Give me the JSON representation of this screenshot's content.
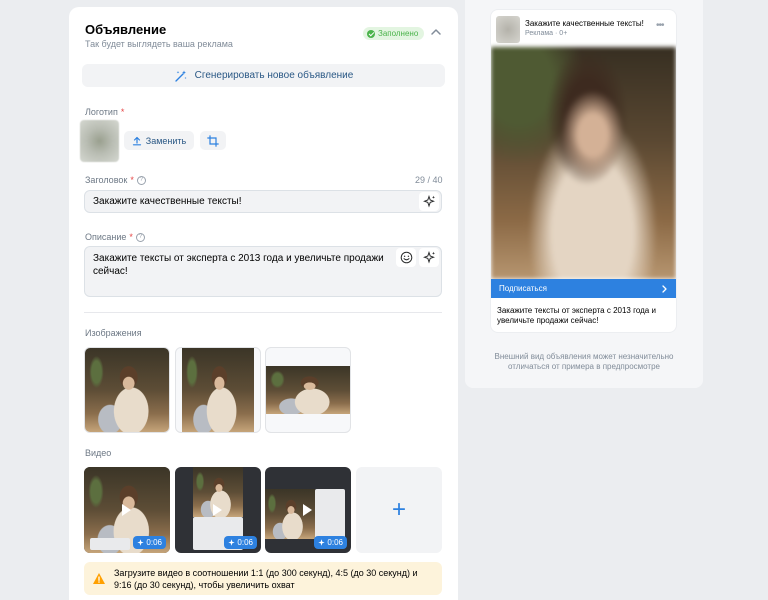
{
  "ad_card": {
    "title": "Объявление",
    "subtitle": "Так будет выглядеть ваша реклама",
    "status": "Заполнено",
    "generate_label": "Сгенерировать новое объявление"
  },
  "logo": {
    "label": "Логотип",
    "required_mark": "*",
    "replace_label": "Заменить"
  },
  "headline": {
    "label": "Заголовок",
    "required_mark": "*",
    "counter": "29 / 40",
    "value": "Закажите качественные тексты!"
  },
  "description": {
    "label": "Описание",
    "required_mark": "*",
    "value": "Закажите тексты от эксперта с 2013 года и увеличьте продажи сейчас!"
  },
  "images": {
    "label": "Изображения"
  },
  "videos": {
    "label": "Видео",
    "items": [
      {
        "duration": "0:06"
      },
      {
        "duration": "0:06"
      },
      {
        "duration": "0:06"
      }
    ],
    "add_symbol": "+"
  },
  "warning": {
    "text": "Загрузите видео в соотношении 1:1 (до 300 секунд), 4:5 (до 30 секунд) и 9:16 (до 30 секунд), чтобы увеличить охват"
  },
  "preview": {
    "title": "Закажите качественные тексты!",
    "meta": "Реклама · 0+",
    "cta": "Подписаться",
    "description": "Закажите тексты от эксперта с 2013 года и увеличьте продажи сейчас!",
    "note": "Внешний вид объявления может незначительно отличаться от примера в предпросмотре"
  },
  "colors": {
    "accent": "#2d81e0",
    "success": "#4bb34b",
    "warning_bg": "#fdf3db",
    "required": "#e64646"
  }
}
